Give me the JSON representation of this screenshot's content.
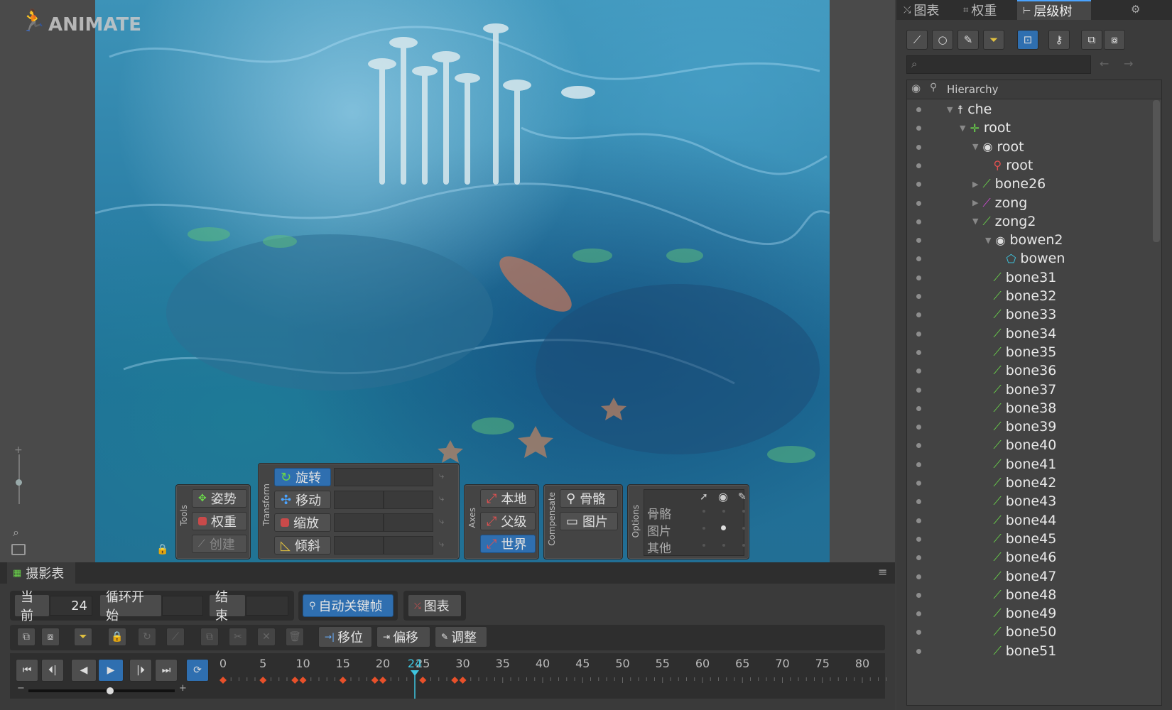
{
  "app": {
    "logo_text": "ANIMATE"
  },
  "colors": {
    "accent": "#2f6fb0",
    "bone_green": "#6ad64a",
    "bone_magenta": "#d04ad6",
    "keyframe": "#e8502a",
    "playhead": "#3ec6e0"
  },
  "viewport": {
    "tools": {
      "label": "Tools",
      "items": [
        "姿势",
        "权重",
        "创建"
      ]
    },
    "transform": {
      "label": "Transform",
      "items": [
        "旋转",
        "移动",
        "缩放",
        "倾斜"
      ],
      "active": "旋转"
    },
    "axes": {
      "label": "Axes",
      "items": [
        "本地",
        "父级",
        "世界"
      ],
      "active": "世界"
    },
    "compensate": {
      "label": "Compensate",
      "items": [
        "骨骼",
        "图片"
      ]
    },
    "options": {
      "label": "Options",
      "rows": [
        "骨骼",
        "图片",
        "其他"
      ]
    }
  },
  "dopesheet": {
    "tab_label": "摄影表",
    "current_label": "当前",
    "current_value": "24",
    "loop_start_label": "循环开始",
    "loop_start_value": "",
    "end_label": "结束",
    "end_value": "",
    "auto_key_label": "自动关键帧",
    "graph_label": "图表",
    "shift_label": "移位",
    "offset_label": "偏移",
    "adjust_label": "调整",
    "current_frame": 24,
    "ticks": [
      "0",
      "5",
      "10",
      "15",
      "20",
      "25",
      "30",
      "35",
      "40",
      "45",
      "50",
      "55",
      "60",
      "65",
      "70",
      "75",
      "80"
    ],
    "playhead_label": "24",
    "keyframes": [
      0,
      5,
      9,
      10,
      15,
      19,
      20,
      25,
      29,
      30
    ]
  },
  "right_panel": {
    "tabs": [
      "图表",
      "权重",
      "层级树"
    ],
    "active_tab": "层级树",
    "search_placeholder": "",
    "header": "Hierarchy",
    "tree": [
      {
        "name": "che",
        "depth": 0,
        "icon": "skeleton-icon",
        "expanded": true
      },
      {
        "name": "root",
        "depth": 1,
        "icon": "root-bone-icon",
        "expanded": true
      },
      {
        "name": "root",
        "depth": 2,
        "icon": "slot-icon",
        "expanded": true
      },
      {
        "name": "root",
        "depth": 3,
        "icon": "attachment-icon",
        "expanded": false
      },
      {
        "name": "bone26",
        "depth": 2,
        "icon": "bone-icon",
        "expanded": false,
        "collapsed": true
      },
      {
        "name": "zong",
        "depth": 2,
        "icon": "bone-magenta-icon",
        "expanded": false,
        "collapsed": true
      },
      {
        "name": "zong2",
        "depth": 2,
        "icon": "bone-icon",
        "expanded": true
      },
      {
        "name": "bowen2",
        "depth": 3,
        "icon": "slot-icon",
        "expanded": true
      },
      {
        "name": "bowen",
        "depth": 4,
        "icon": "mesh-icon",
        "expanded": false
      },
      {
        "name": "bone31",
        "depth": 3,
        "icon": "bone-icon"
      },
      {
        "name": "bone32",
        "depth": 3,
        "icon": "bone-icon"
      },
      {
        "name": "bone33",
        "depth": 3,
        "icon": "bone-icon"
      },
      {
        "name": "bone34",
        "depth": 3,
        "icon": "bone-icon"
      },
      {
        "name": "bone35",
        "depth": 3,
        "icon": "bone-icon"
      },
      {
        "name": "bone36",
        "depth": 3,
        "icon": "bone-icon"
      },
      {
        "name": "bone37",
        "depth": 3,
        "icon": "bone-icon"
      },
      {
        "name": "bone38",
        "depth": 3,
        "icon": "bone-icon"
      },
      {
        "name": "bone39",
        "depth": 3,
        "icon": "bone-icon"
      },
      {
        "name": "bone40",
        "depth": 3,
        "icon": "bone-icon"
      },
      {
        "name": "bone41",
        "depth": 3,
        "icon": "bone-icon"
      },
      {
        "name": "bone42",
        "depth": 3,
        "icon": "bone-icon"
      },
      {
        "name": "bone43",
        "depth": 3,
        "icon": "bone-icon"
      },
      {
        "name": "bone44",
        "depth": 3,
        "icon": "bone-icon"
      },
      {
        "name": "bone45",
        "depth": 3,
        "icon": "bone-icon"
      },
      {
        "name": "bone46",
        "depth": 3,
        "icon": "bone-icon"
      },
      {
        "name": "bone47",
        "depth": 3,
        "icon": "bone-icon"
      },
      {
        "name": "bone48",
        "depth": 3,
        "icon": "bone-icon"
      },
      {
        "name": "bone49",
        "depth": 3,
        "icon": "bone-icon"
      },
      {
        "name": "bone50",
        "depth": 3,
        "icon": "bone-icon"
      },
      {
        "name": "bone51",
        "depth": 3,
        "icon": "bone-icon"
      }
    ]
  }
}
